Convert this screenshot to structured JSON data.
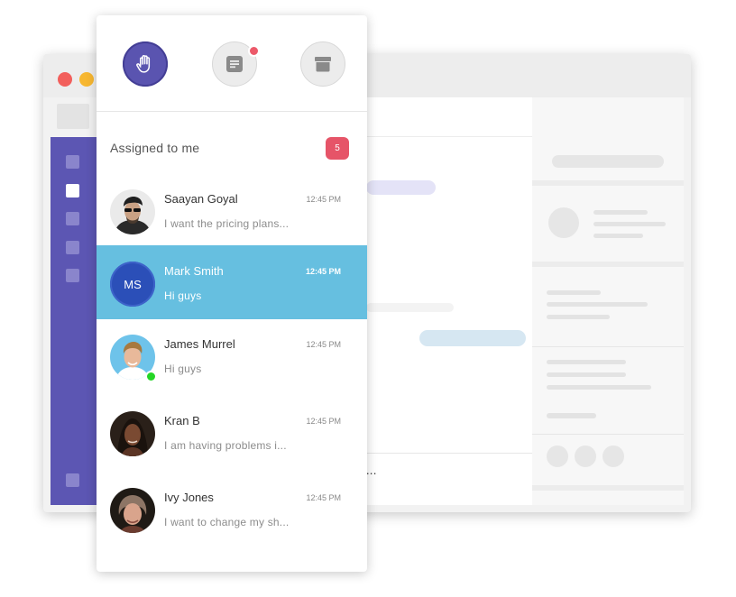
{
  "background_app": {
    "composer_partial_text": "e..."
  },
  "top_icons": [
    {
      "name": "hand-icon",
      "active": true
    },
    {
      "name": "document-icon",
      "has_notification": true
    },
    {
      "name": "archive-icon",
      "active": false
    }
  ],
  "inbox": {
    "section_title": "Assigned to me",
    "count": "5"
  },
  "conversations": [
    {
      "name": "Saayan Goyal",
      "time": "12:45 PM",
      "preview": "I want the pricing plans...",
      "avatar": "photo",
      "selected": false,
      "online": false
    },
    {
      "name": "Mark Smith",
      "time": "12:45 PM",
      "preview": "Hi guys",
      "avatar_initials": "MS",
      "selected": true,
      "online": false
    },
    {
      "name": "James Murrel",
      "time": "12:45 PM",
      "preview": "Hi guys",
      "avatar": "photo",
      "selected": false,
      "online": true
    },
    {
      "name": "Kran B",
      "time": "12:45 PM",
      "preview": "I am having problems i...",
      "avatar": "photo",
      "selected": false,
      "online": false
    },
    {
      "name": "Ivy Jones",
      "time": "12:45 PM",
      "preview": "I want to change my sh...",
      "avatar": "photo",
      "selected": false,
      "online": false
    }
  ],
  "colors": {
    "brand_purple": "#5a54b0",
    "selected_row": "#66bfe0",
    "badge_red": "#e65468",
    "online_green": "#24d626"
  }
}
